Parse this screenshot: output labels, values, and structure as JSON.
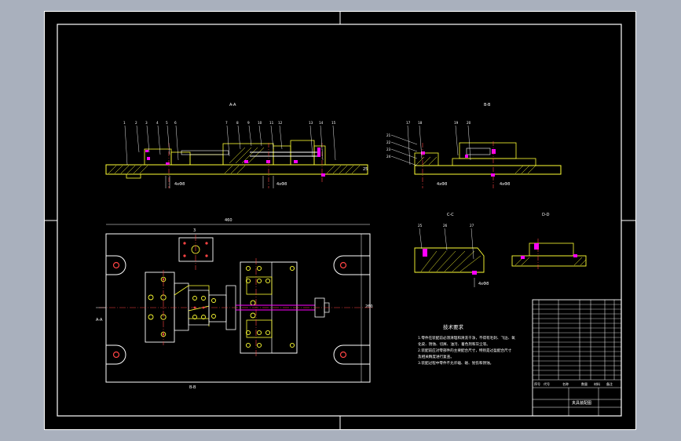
{
  "drawing": {
    "section_titles": [
      "A-A",
      "B-B",
      "C-C",
      "D-D"
    ],
    "balloons_top_left": [
      "1",
      "2",
      "3",
      "4",
      "5",
      "6",
      "7",
      "8",
      "9",
      "10",
      "11",
      "12",
      "13",
      "14",
      "15",
      "16"
    ],
    "balloons_top_right": [
      "17",
      "18",
      "19",
      "20",
      "21",
      "22",
      "23",
      "24"
    ],
    "balloons_cc": [
      "25",
      "26",
      "27"
    ],
    "dims": {
      "plan_width": "460",
      "plan_depth_left": "A-A",
      "plan_depth_right": "260",
      "plan_bottom": "B-B",
      "plate_thk": "25",
      "hole_spec": "4xΦ8"
    },
    "tech_req": {
      "title": "技术要求",
      "lines": [
        "1.零件在装配前必须清理和清洗干净，不得有毛刺、飞边、氧",
        "化皮、锈蚀、切屑、油污、着色剂和灰尘等。",
        "2.装配前应对零部件的主要配合尺寸，特别是过盈配合尺寸",
        "及相关精度进行复查。",
        "3.装配过程中零件不允许磕、碰、划伤和锈蚀。"
      ]
    },
    "title_block": {
      "headers": [
        "序号",
        "代号",
        "名称",
        "数量",
        "材料",
        "备注"
      ],
      "footer": "夹具装配图"
    }
  }
}
